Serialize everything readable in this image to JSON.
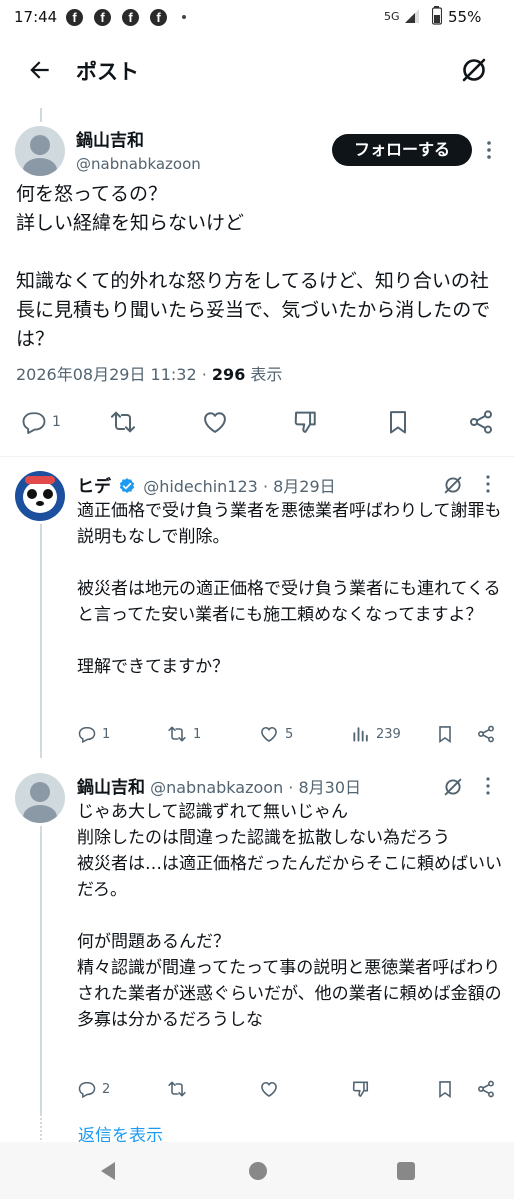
{
  "status_bar": {
    "time": "17:44",
    "network": "5G",
    "battery": "55%"
  },
  "header": {
    "title": "ポスト",
    "back_icon": "arrow-left-icon",
    "action_icon": "grok-icon"
  },
  "main_post": {
    "author_name": "鍋山吉和",
    "author_handle": "@nabnabkazoon",
    "follow_label": "フォローする",
    "text": "何を怒ってるの？\n詳しい経緯を知らないけど\n\n知識なくて的外れな怒り方をしてるけど、知り合いの社長に見積もり聞いたら妥当で、気づいたから消したのでは？",
    "timestamp": "2026年08月29日 11:32",
    "separator": "·",
    "views_count": "296",
    "views_label": "表示",
    "reply_count": "1"
  },
  "replies": [
    {
      "author_name": "ヒデ",
      "author_handle": "@hidechin123",
      "date": "· 8月29日",
      "verified": true,
      "text": "適正価格で受け負う業者を悪徳業者呼ばわりして謝罪も説明もなしで削除。\n\n被災者は地元の適正価格で受け負う業者にも連れてくると言ってた安い業者にも施工頼めなくなってますよ？\n\n理解できてますか？",
      "reply_count": "1",
      "repost_count": "1",
      "like_count": "5",
      "view_count": "239"
    },
    {
      "author_name": "鍋山吉和",
      "author_handle": "@nabnabkazoon",
      "date": "· 8月30日",
      "verified": false,
      "text": "じゃあ大して認識ずれて無いじゃん\n削除したのは間違った認識を拡散しない為だろう\n被災者は…は適正価格だったんだからそこに頼めばいいだろ。\n\n何が問題あるんだ？\n精々認識が間違ってたって事の説明と悪徳業者呼ばわりされた業者が迷惑ぐらいだが、他の業者に頼めば金額の多寡は分かるだろうしな",
      "reply_count": "2"
    }
  ],
  "show_replies_label": "返信を表示",
  "colors": {
    "accent": "#1d9bf0",
    "text": "#0f1419",
    "secondary": "#536471"
  }
}
